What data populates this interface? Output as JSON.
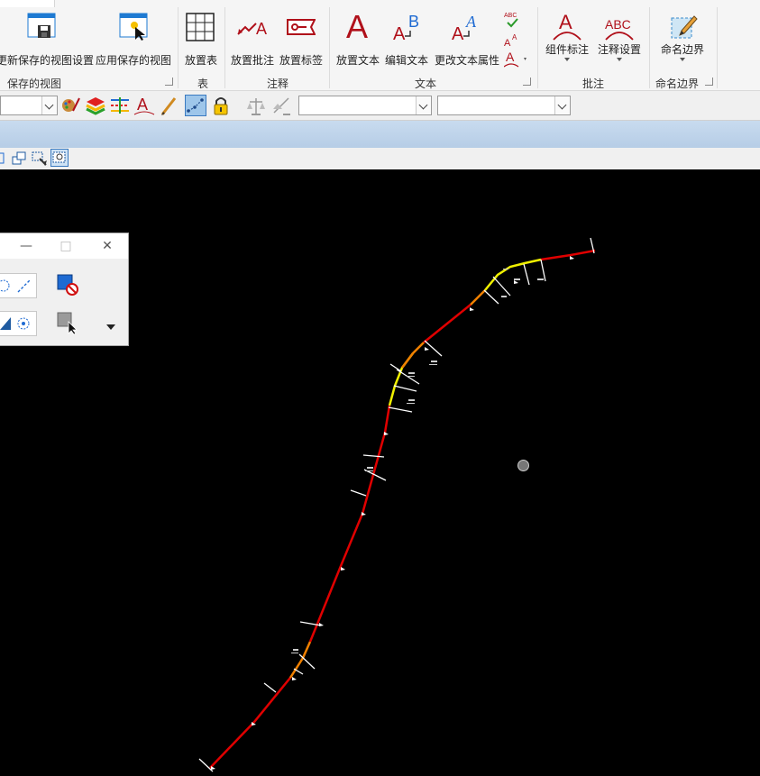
{
  "ribbon": {
    "groups": {
      "saved_views": {
        "label": "保存的视图",
        "update_label": "更新保存的视图设置",
        "apply_label": "应用保存的视图"
      },
      "table": {
        "label": "表",
        "place_table_label": "放置表"
      },
      "annotation": {
        "label": "注释",
        "place_note_label": "放置批注",
        "place_label_label": "放置标签"
      },
      "text": {
        "label": "文本",
        "place_text_label": "放置文本",
        "edit_text_label": "编辑文本",
        "change_text_props_label": "更改文本属性",
        "spell_label": "ABC"
      },
      "notes": {
        "label": "批注",
        "element_annotation_label": "组件标注",
        "annotation_settings_label": "注释设置",
        "abc_glyph": "ABC"
      },
      "named_boundary": {
        "label": "命名边界",
        "button_label": "命名边界"
      }
    }
  },
  "toolbar": {
    "level_combo": "",
    "text_style_combo": "",
    "dim_style_combo": ""
  },
  "canvas": {
    "background": "#000000",
    "alignment_colors": {
      "tangent": "#e00000",
      "spiral": "#f08000",
      "curve": "#f0f000",
      "ticks": "#ffffff"
    }
  },
  "float_window": {
    "minimize": "—",
    "maximize": "□",
    "close": "✕"
  }
}
